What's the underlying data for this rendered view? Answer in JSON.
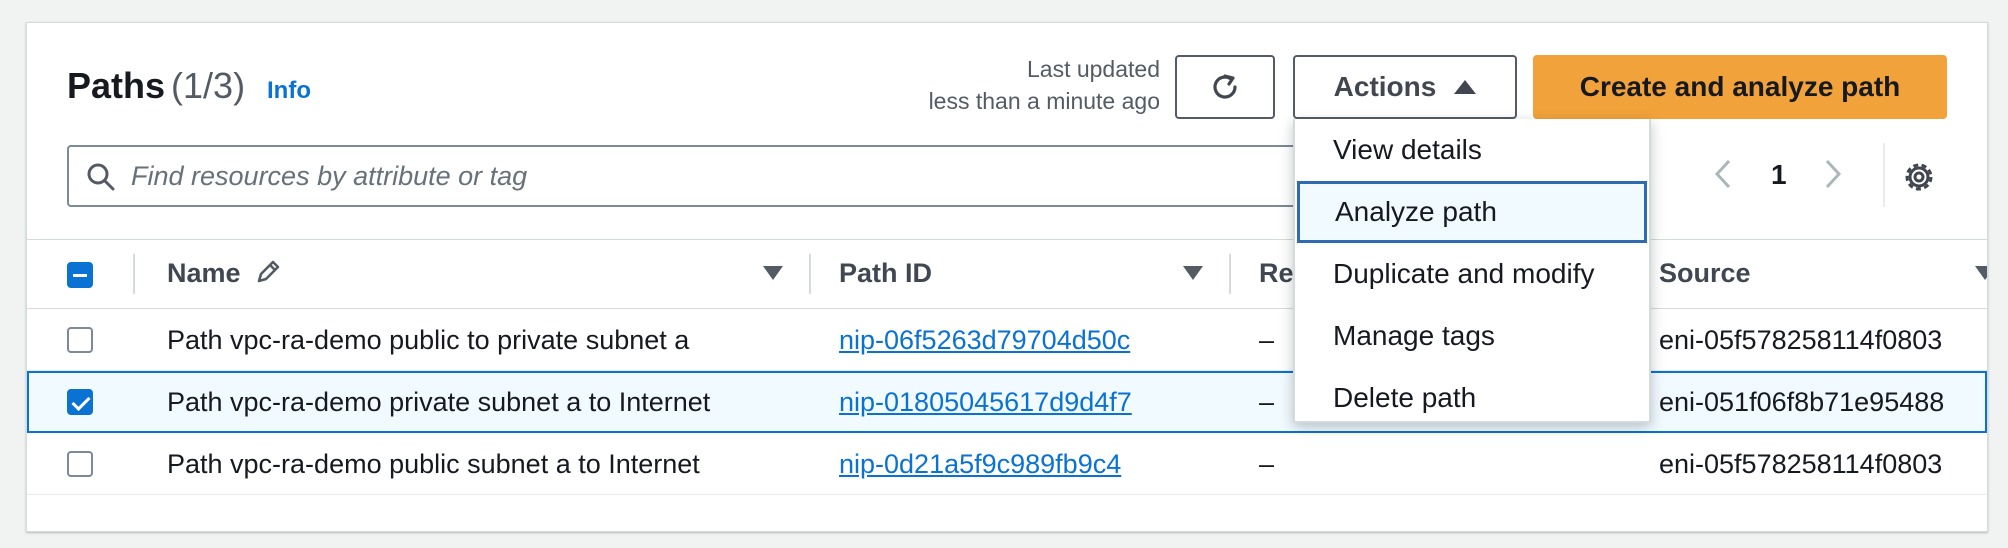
{
  "header": {
    "title": "Paths",
    "count": "(1/3)",
    "info_label": "Info",
    "last_updated_line1": "Last updated",
    "last_updated_line2": "less than a minute ago"
  },
  "toolbar": {
    "actions_label": "Actions",
    "create_label": "Create and analyze path"
  },
  "search": {
    "placeholder": "Find resources by attribute or tag"
  },
  "pagination": {
    "page": "1"
  },
  "columns": [
    "Name",
    "Path ID",
    "Re",
    "Source"
  ],
  "rows": [
    {
      "name": "Path vpc-ra-demo public to private subnet a",
      "path_id": "nip-06f5263d79704d50c",
      "re": "–",
      "source": "eni-05f578258114f0803",
      "selected": false
    },
    {
      "name": "Path vpc-ra-demo private subnet a to Internet",
      "path_id": "nip-01805045617d9d4f7",
      "re": "–",
      "source": "eni-051f06f8b71e95488",
      "selected": true
    },
    {
      "name": "Path vpc-ra-demo public subnet a to Internet",
      "path_id": "nip-0d21a5f9c989fb9c4",
      "re": "–",
      "source": "eni-05f578258114f0803",
      "selected": false
    }
  ],
  "actions_menu": [
    "View details",
    "Analyze path",
    "Duplicate and modify",
    "Manage tags",
    "Delete path"
  ],
  "colors": {
    "primary": "#f2a23a",
    "link": "#0972d3",
    "selected_bg": "#f1faff"
  }
}
